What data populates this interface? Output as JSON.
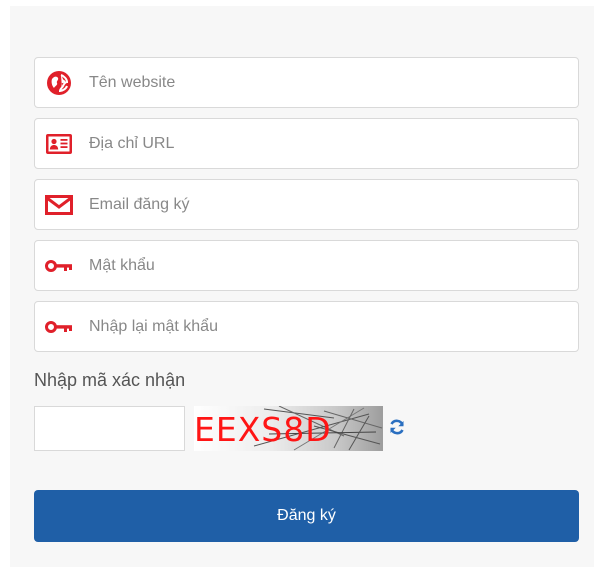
{
  "form": {
    "fields": [
      {
        "name": "website",
        "placeholder": "Tên website",
        "value": "",
        "icon": "globe-icon"
      },
      {
        "name": "url",
        "placeholder": "Địa chỉ URL",
        "value": "",
        "icon": "id-card-icon"
      },
      {
        "name": "email",
        "placeholder": "Email đăng ký",
        "value": "",
        "icon": "envelope-icon"
      },
      {
        "name": "password",
        "placeholder": "Mật khẩu",
        "value": "",
        "icon": "key-icon"
      },
      {
        "name": "password_confirm",
        "placeholder": "Nhập lại mật khẩu",
        "value": "",
        "icon": "key-icon"
      }
    ],
    "captcha": {
      "label": "Nhập mã xác nhận",
      "value": "",
      "code": "EEXS8D",
      "refresh_icon": "refresh-icon"
    },
    "submit_label": "Đăng ký"
  },
  "colors": {
    "panel_bg": "#f7f7f7",
    "icon_red": "#e0202a",
    "primary_button": "#1f5fa7",
    "captcha_text": "#ff1515",
    "refresh_blue": "#2a6fc0"
  }
}
